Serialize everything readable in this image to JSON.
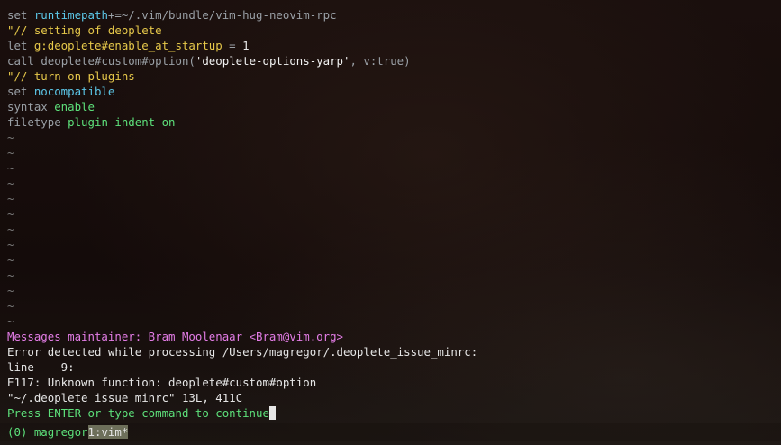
{
  "editor": {
    "lines": [
      {
        "parts": [
          {
            "t": "set ",
            "c": "kw"
          },
          {
            "t": "runtimepath",
            "c": "opt"
          },
          {
            "t": "+=~/.vim/bundle/vim-hug-neovim-rpc",
            "c": "kw"
          }
        ]
      },
      {
        "parts": [
          {
            "t": "\"// setting of deoplete",
            "c": "cmt"
          }
        ]
      },
      {
        "parts": [
          {
            "t": "let ",
            "c": "kw"
          },
          {
            "t": "g:deoplete#enable_at_startup",
            "c": "var"
          },
          {
            "t": " = ",
            "c": "kw"
          },
          {
            "t": "1",
            "c": "num"
          }
        ]
      },
      {
        "parts": [
          {
            "t": "call ",
            "c": "kw"
          },
          {
            "t": "deoplete#custom#option(",
            "c": "kw"
          },
          {
            "t": "'deoplete-options-yarp'",
            "c": "str"
          },
          {
            "t": ", v:true)",
            "c": "kw"
          }
        ]
      },
      {
        "parts": [
          {
            "t": "\"// turn on plugins",
            "c": "cmt"
          }
        ]
      },
      {
        "parts": [
          {
            "t": "set ",
            "c": "kw"
          },
          {
            "t": "nocompatible",
            "c": "opt"
          }
        ]
      },
      {
        "parts": [
          {
            "t": "syntax ",
            "c": "kw"
          },
          {
            "t": "enable",
            "c": "green"
          }
        ]
      },
      {
        "parts": [
          {
            "t": "filetype ",
            "c": "kw"
          },
          {
            "t": "plugin indent on",
            "c": "green"
          }
        ]
      }
    ],
    "tilde_char": "~",
    "tilde_count": 13
  },
  "messages": {
    "maintainer": "Messages maintainer: Bram Moolenaar <Bram@vim.org>",
    "error_header": "Error detected while processing /Users/magregor/.deoplete_issue_minrc:",
    "line_info": "line    9:",
    "error_text": "E117: Unknown function: deoplete#custom#option",
    "file_info": "\"~/.deoplete_issue_minrc\" 13L, 411C",
    "prompt": "Press ENTER or type command to continue"
  },
  "tmux": {
    "session": "(0) magregor",
    "window": "1:vim*"
  }
}
